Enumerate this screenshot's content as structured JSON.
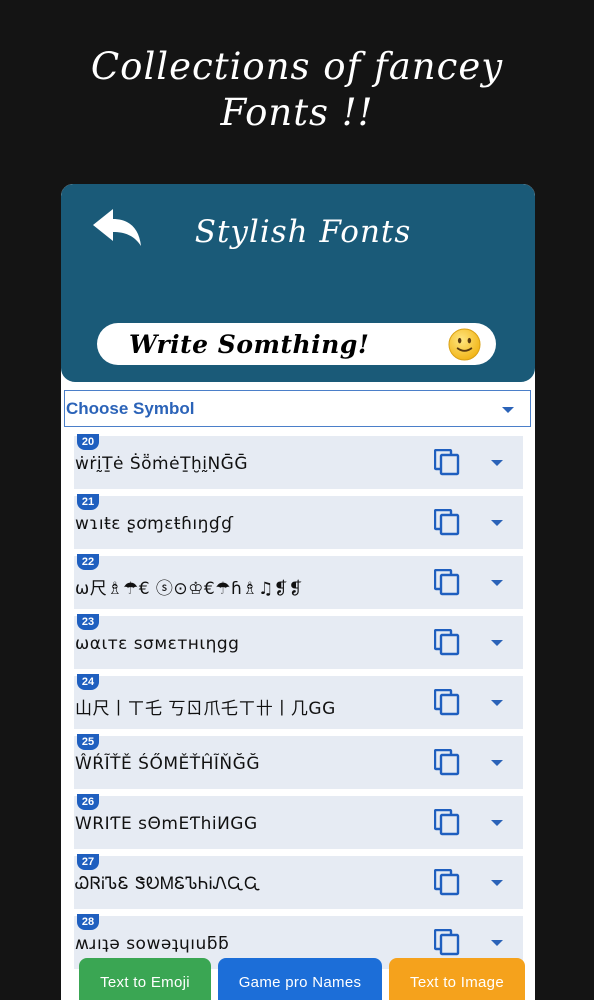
{
  "headline": {
    "line1": "Collections of fancey",
    "line2": "Fonts !!"
  },
  "appbar": {
    "title": "Stylish Fonts",
    "back_icon": "back-arrow-icon"
  },
  "write": {
    "placeholder": "Write Somthing!",
    "emoji_icon": "smiley-icon"
  },
  "choose_symbol": {
    "label": "Choose Symbol"
  },
  "rows": [
    {
      "num": "20",
      "text": "ẇṙḭṮė ṠṏṁėṮḫḭṆḠḠ"
    },
    {
      "num": "21",
      "text": "wɿıŧɛ ʂơɱɛŧɦıŋɠɠ"
    },
    {
      "num": "22",
      "text": "ω尺♗☂€ ⓢ⊙♔€☂ɦ♗♫❡❡"
    },
    {
      "num": "23",
      "text": "ωαιтε ѕσмεтнιηgg"
    },
    {
      "num": "24",
      "text": "山尺丨ㄒ乇 丂ㄖ爪乇ㄒ卄丨几GG"
    },
    {
      "num": "25",
      "text": "ŴŔĨŤĚ ŚŐMĚŤĤĨŇĞĞ"
    },
    {
      "num": "26",
      "text": "WRIƬE sΘmEƬhiИGG"
    },
    {
      "num": "27",
      "text": "ᏇᏒᎥᏖᏋ ᏕᎧᎷᏋᏖᏂᎥᏁᏩᏩ"
    },
    {
      "num": "28",
      "text": "ʍɹıʇǝ sowǝʇɥıuƃƃ"
    }
  ],
  "bottom_buttons": [
    {
      "label": "Text to Emoji",
      "color": "#3aa653"
    },
    {
      "label": "Game pro Names",
      "color": "#1c6ed8"
    },
    {
      "label": "Text to Image",
      "color": "#f5a21c"
    }
  ],
  "colors": {
    "appbar": "#1a5a78",
    "accent": "#1f5fbf",
    "row_bg": "#e6ebf3"
  }
}
